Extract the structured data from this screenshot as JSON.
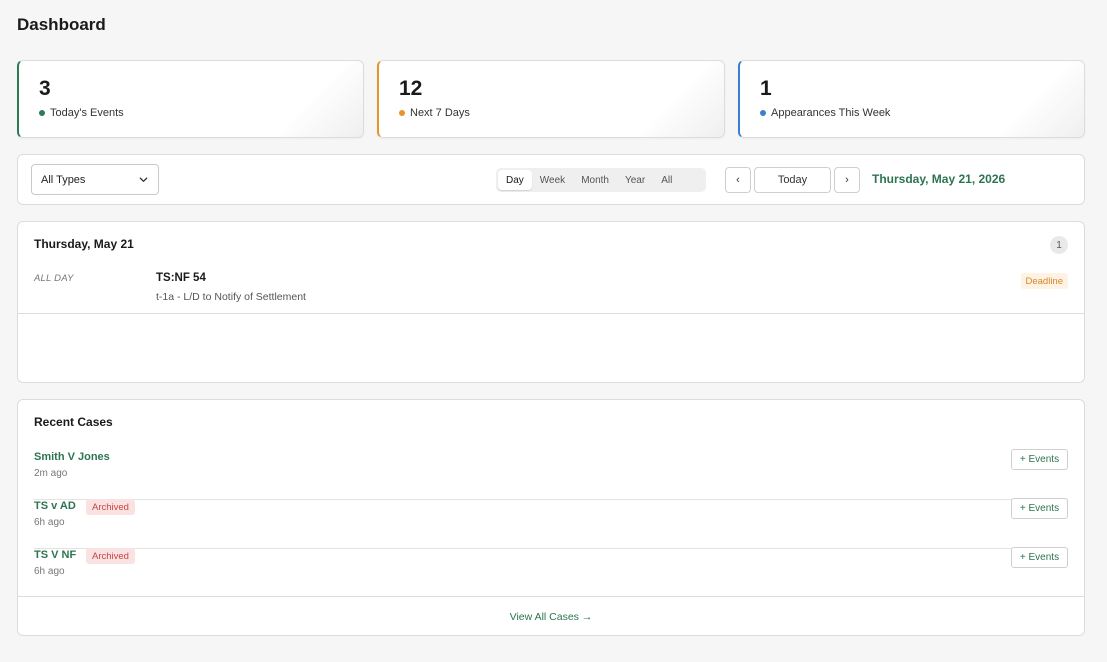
{
  "page": {
    "title": "Dashboard"
  },
  "stats": [
    {
      "value": "3",
      "label": "Today's Events",
      "color": "#2f7a57"
    },
    {
      "value": "12",
      "label": "Next 7 Days",
      "color": "#e6952a"
    },
    {
      "value": "1",
      "label": "Appearances This Week",
      "color": "#3d7fcf"
    }
  ],
  "toolbar": {
    "type_filter": "All Types",
    "ranges": [
      "Day",
      "Week",
      "Month",
      "Year",
      "All"
    ],
    "active_range": "Day",
    "prev": "‹",
    "today": "Today",
    "next": "›",
    "current_date": "Thursday, May 21, 2026"
  },
  "day": {
    "heading": "Thursday, May 21",
    "count": "1",
    "events": [
      {
        "time": "ALL DAY",
        "title": "TS:NF 54",
        "description": "t-1a - L/D to Notify of Settlement",
        "tag": "Deadline"
      }
    ]
  },
  "recent_cases": {
    "heading": "Recent Cases",
    "items": [
      {
        "name": "Smith V Jones",
        "tag": "",
        "time": "2m ago",
        "action": "+ Events"
      },
      {
        "name": "TS v AD",
        "tag": "Archived",
        "time": "6h ago",
        "action": "+ Events"
      },
      {
        "name": "TS V NF",
        "tag": "Archived",
        "time": "6h ago",
        "action": "+ Events"
      }
    ],
    "footer_link": "View All Cases →"
  },
  "colors": {
    "accent": "#2d7450",
    "archived_bg": "#fbe2e2",
    "archived_text": "#c84545",
    "deadline_bg": "#fdf2e3",
    "deadline_text": "#d9862b"
  }
}
